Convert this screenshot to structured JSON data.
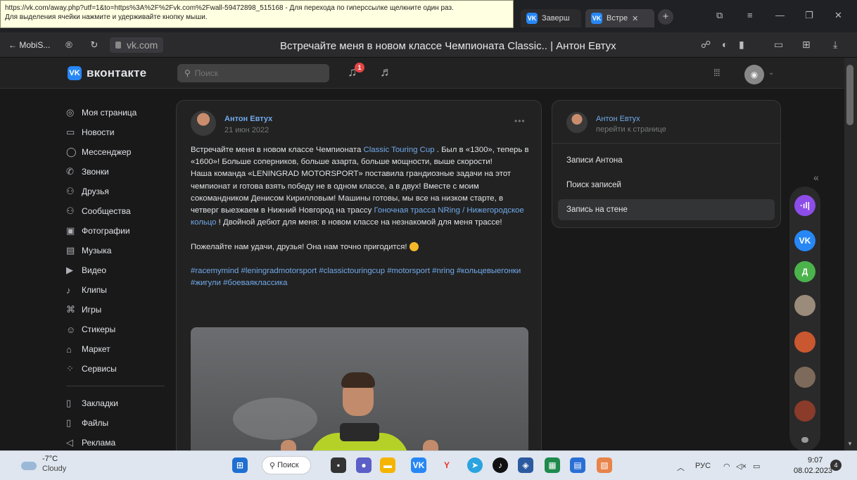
{
  "tooltip": {
    "line1": "https://vk.com/away.php?utf=1&to=https%3A%2F%2Fvk.com%2Fwall-59472898_515168 - Для перехода по гиперссылке щелкните один раз.",
    "line2": "Для выделения ячейки нажмите и удерживайте кнопку мыши."
  },
  "tabs": [
    {
      "label": "Заверш"
    },
    {
      "label": "Встре"
    }
  ],
  "browser": {
    "back_label": "← MobiS...",
    "url": "vk.com",
    "page_title": "Встречайте меня в новом классе Чемпионата Classic.. | Антон Евтух"
  },
  "vk_header": {
    "brand": "вконтакте",
    "search_placeholder": "Поиск",
    "notif_count": "1"
  },
  "menu": {
    "items": [
      {
        "label": "Моя страница",
        "icon": "◎"
      },
      {
        "label": "Новости",
        "icon": "▭"
      },
      {
        "label": "Мессенджер",
        "icon": "◯"
      },
      {
        "label": "Звонки",
        "icon": "✆"
      },
      {
        "label": "Друзья",
        "icon": "⚇"
      },
      {
        "label": "Сообщества",
        "icon": "⚇"
      },
      {
        "label": "Фотографии",
        "icon": "▣"
      },
      {
        "label": "Музыка",
        "icon": "▤"
      },
      {
        "label": "Видео",
        "icon": "▶"
      },
      {
        "label": "Клипы",
        "icon": "♪"
      },
      {
        "label": "Игры",
        "icon": "⌘"
      },
      {
        "label": "Стикеры",
        "icon": "☺"
      },
      {
        "label": "Маркет",
        "icon": "⌂"
      },
      {
        "label": "Сервисы",
        "icon": "⁘"
      }
    ],
    "extra": [
      {
        "label": "Закладки",
        "icon": "▯"
      },
      {
        "label": "Файлы",
        "icon": "▯"
      },
      {
        "label": "Реклама",
        "icon": "◁"
      }
    ]
  },
  "post": {
    "author": "Антон Евтух",
    "date": "21 июн 2022",
    "more": "•••",
    "p1_a": "Встречайте меня в новом классе Чемпионата ",
    "p1_link": "Classic Touring Cup",
    "p1_b": " . Был в «1300», теперь в «1600»! Больше соперников, больше азарта, больше мощности, выше скорости!",
    "p2_a": "Наша команда «LENINGRAD MOTORSPORT» поставила грандиозные задачи на этот чемпионат и готова взять победу не в одном классе, а в двух! Вместе с моим сокомандником Денисом Кирилловым! Машины готовы, мы все на низком старте, в четверг выезжаем в Нижний Новгород на трассу ",
    "p2_link": "Гоночная трасса NRing / Нижегородское кольцо",
    "p2_b": " ! Двойной дебют для меня: в новом классе на незнакомой для меня трассе!",
    "p3": "Пожелайте нам удачи, друзья! Она нам точно пригодится! ",
    "hashtags": "#racemymind #leningradmotorsport #classictouringcup #motorsport #nring #кольцевыегонки #жигули #боеваяклассика"
  },
  "right_card": {
    "name": "Антон Евтух",
    "sub": "перейти к странице",
    "items": [
      "Записи Антона",
      "Поиск записей",
      "Запись на стене"
    ]
  },
  "rail": {
    "items": [
      {
        "label": "·ıl|",
        "color": "#8d4de8"
      },
      {
        "label": "VK",
        "color": "#2787f5"
      },
      {
        "label": "Д",
        "color": "#4bb34b"
      },
      {
        "label": "",
        "color": "#9a8b7a"
      },
      {
        "label": "",
        "color": "#c9572f"
      },
      {
        "label": "",
        "color": "#7e6a5a"
      },
      {
        "label": "",
        "color": "#8a3b2a"
      }
    ]
  },
  "taskbar": {
    "temp": "-7°C",
    "condition": "Cloudy",
    "search_label": "Поиск",
    "lang": "РУС",
    "time": "9:07",
    "date": "08.02.2023",
    "notif": "4"
  }
}
